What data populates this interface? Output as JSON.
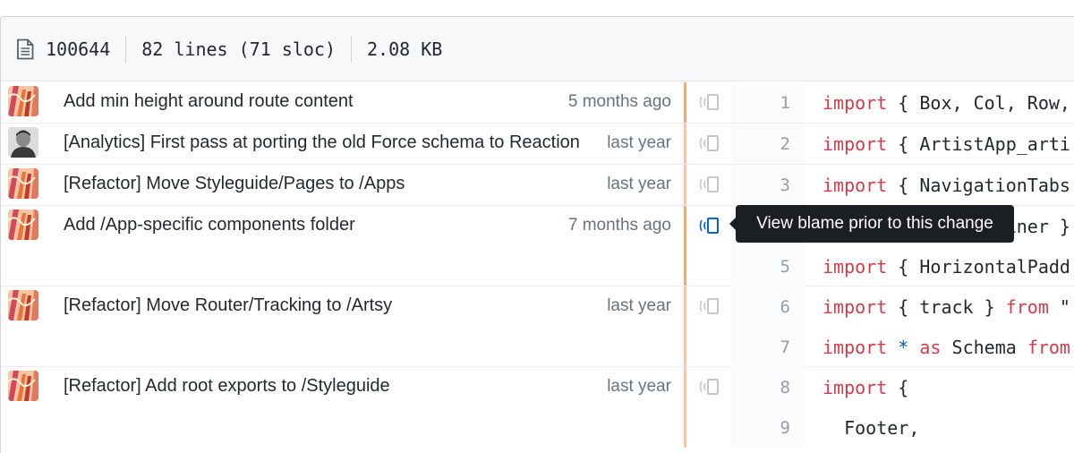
{
  "file_info": {
    "mode": "100644",
    "lines": "82 lines (71 sloc)",
    "size": "2.08 KB"
  },
  "tooltip": "View blame prior to this change",
  "hunks": [
    {
      "message": "Add min height around route content",
      "date": "5 months ago",
      "avatar": "pattern-avatar",
      "lines": [
        {
          "num": "1",
          "parts": [
            [
              "kw",
              "import"
            ],
            [
              "txt",
              " { Box, Col, Row,"
            ]
          ]
        }
      ]
    },
    {
      "message": "[Analytics] First pass at porting the old Force schema to Reaction",
      "date": "last year",
      "avatar": "photo-avatar",
      "lines": [
        {
          "num": "2",
          "parts": [
            [
              "kw",
              "import"
            ],
            [
              "txt",
              " { ArtistApp_arti"
            ]
          ]
        }
      ]
    },
    {
      "message": "[Refactor] Move Styleguide/Pages to /Apps",
      "date": "last year",
      "avatar": "pattern-avatar",
      "lines": [
        {
          "num": "3",
          "parts": [
            [
              "kw",
              "import"
            ],
            [
              "txt",
              " { NavigationTabs"
            ]
          ]
        }
      ]
    },
    {
      "message": "Add /App-specific components folder",
      "date": "7 months ago",
      "avatar": "pattern-avatar",
      "lines": [
        {
          "num": "4",
          "parts": [
            [
              "kw",
              "import"
            ],
            [
              "txt",
              " { AppContainer }"
            ]
          ]
        },
        {
          "num": "5",
          "parts": [
            [
              "kw",
              "import"
            ],
            [
              "txt",
              " { HorizontalPadd"
            ]
          ]
        }
      ]
    },
    {
      "message": "[Refactor] Move Router/Tracking to /Artsy",
      "date": "last year",
      "avatar": "pattern-avatar",
      "lines": [
        {
          "num": "6",
          "parts": [
            [
              "kw",
              "import"
            ],
            [
              "txt",
              " { track } "
            ],
            [
              "kw",
              "from"
            ],
            [
              "txt",
              " \""
            ]
          ]
        },
        {
          "num": "7",
          "parts": [
            [
              "kw",
              "import"
            ],
            [
              "txt",
              " "
            ],
            [
              "op",
              "*"
            ],
            [
              "txt",
              " "
            ],
            [
              "kw",
              "as"
            ],
            [
              "txt",
              " Schema "
            ],
            [
              "kw",
              "from"
            ]
          ]
        }
      ]
    },
    {
      "message": "[Refactor] Add root exports to /Styleguide",
      "date": "last year",
      "avatar": "pattern-avatar",
      "lines": [
        {
          "num": "8",
          "parts": [
            [
              "kw",
              "import"
            ],
            [
              "txt",
              " {"
            ]
          ]
        },
        {
          "num": "9",
          "parts": [
            [
              "txt",
              "  Footer,"
            ]
          ]
        }
      ]
    }
  ]
}
